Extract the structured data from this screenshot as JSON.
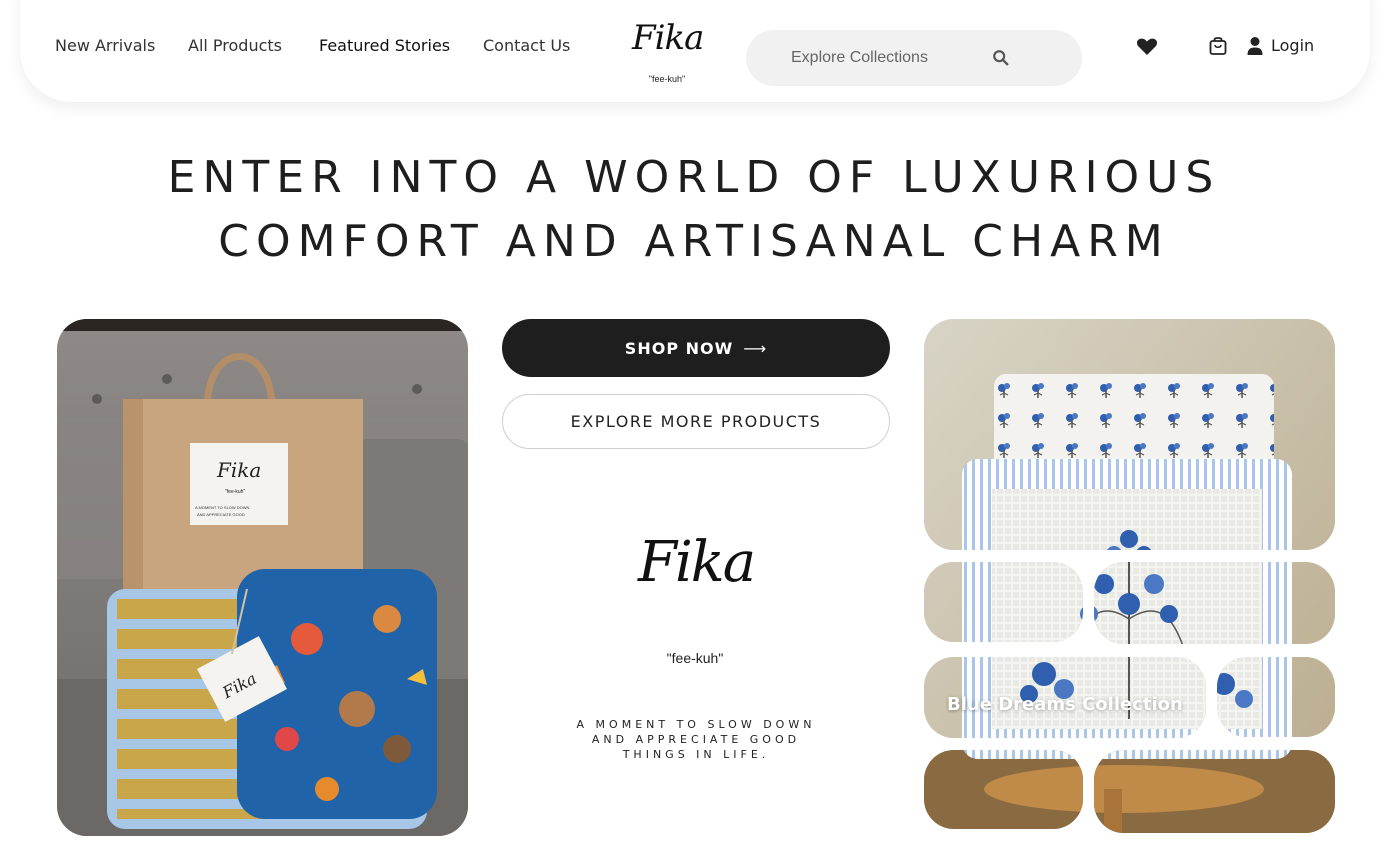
{
  "nav": {
    "items": [
      {
        "label": "New Arrivals"
      },
      {
        "label": "All Products"
      },
      {
        "label": "Featured Stories"
      },
      {
        "label": "Contact Us"
      }
    ]
  },
  "brand": {
    "name": "Fika",
    "pronunciation": "\"fee-kuh\""
  },
  "search": {
    "placeholder": "Explore Collections"
  },
  "header_icons": [
    "heart-icon",
    "shopping-bag-icon",
    "user-icon"
  ],
  "login": {
    "label": "Login"
  },
  "hero": {
    "line1": "ENTER INTO A WORLD OF LUXURIOUS",
    "line2": "COMFORT AND ARTISANAL CHARM"
  },
  "actions": {
    "shop_now": "SHOP NOW",
    "shop_arrow": "⟶",
    "explore_more": "EXPLORE MORE PRODUCTS"
  },
  "center": {
    "logo": "Fika",
    "pronunciation": "\"fee-kuh\"",
    "tagline_lines": [
      "A MOMENT TO SLOW DOWN",
      "AND APPRECIATE GOOD",
      "THINGS IN LIFE."
    ]
  },
  "collection": {
    "label": "Blue Dreams Collection"
  },
  "colors": {
    "dark": "#1e1e1e",
    "accent_blue": "#2f5fae",
    "bg": "#ffffff"
  }
}
